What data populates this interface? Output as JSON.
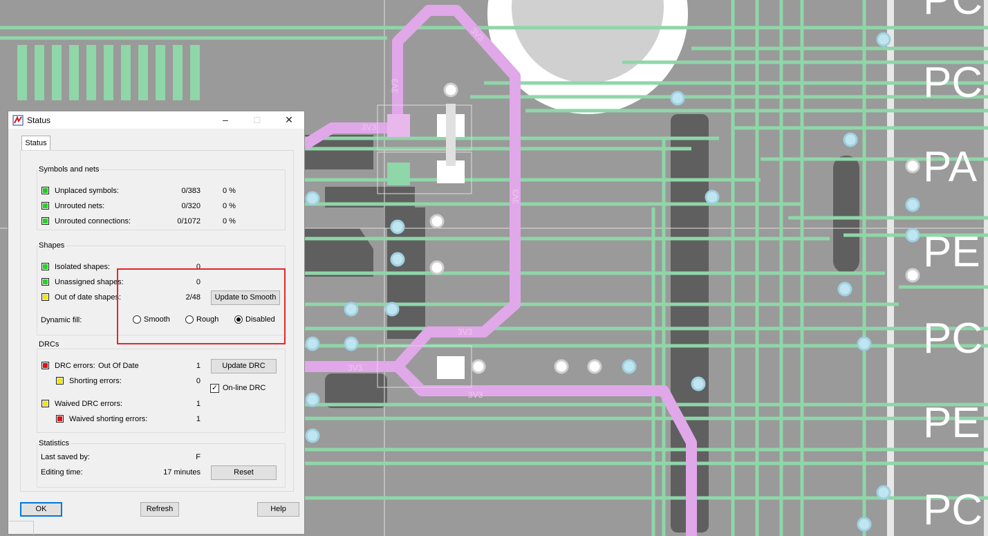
{
  "pcb": {
    "net_labels": [
      "3V3",
      "3V3",
      "3V3",
      "3V3",
      "3V3",
      "3V3",
      "3V3"
    ],
    "silk_labels": [
      "PC",
      "PC",
      "PA",
      "PE",
      "PC",
      "PE",
      "PC"
    ]
  },
  "dialog": {
    "title": "Status",
    "controls": {
      "minimize": "–",
      "maximize": "□",
      "close": "✕"
    },
    "tab": "Status",
    "symbols_nets": {
      "title": "Symbols and nets",
      "rows": [
        {
          "label": "Unplaced symbols:",
          "count": "0/383",
          "pct": "0 %",
          "color": "#22c822"
        },
        {
          "label": "Unrouted nets:",
          "count": "0/320",
          "pct": "0 %",
          "color": "#22d522"
        },
        {
          "label": "Unrouted connections:",
          "count": "0/1072",
          "pct": "0 %",
          "color": "#22d522"
        }
      ]
    },
    "shapes": {
      "title": "Shapes",
      "rows": [
        {
          "label": "Isolated shapes:",
          "count": "0",
          "color": "#22d522"
        },
        {
          "label": "Unassigned shapes:",
          "count": "0",
          "color": "#22d522"
        },
        {
          "label": "Out of date shapes:",
          "count": "2/48",
          "color": "#f0e800"
        }
      ],
      "update_button": "Update to Smooth",
      "dynamic_fill_label": "Dynamic fill:",
      "options": [
        "Smooth",
        "Rough",
        "Disabled"
      ],
      "selected": "Disabled"
    },
    "drcs": {
      "title": "DRCs",
      "drc_errors": {
        "label": "DRC errors:",
        "status": "Out Of Date",
        "count": "1",
        "color": "#e01010"
      },
      "shorting_errors": {
        "label": "Shorting errors:",
        "count": "0",
        "color": "#f0e800"
      },
      "waived_drc": {
        "label": "Waived DRC errors:",
        "count": "1",
        "color": "#f0e800"
      },
      "waived_shorting": {
        "label": "Waived shorting errors:",
        "count": "1",
        "color": "#e01010"
      },
      "update_button": "Update DRC",
      "online_drc": "On-line DRC",
      "online_checked": true
    },
    "statistics": {
      "title": "Statistics",
      "last_saved_label": "Last saved by:",
      "last_saved_value": "F",
      "editing_label": "Editing time:",
      "editing_value": "17 minutes",
      "reset_button": "Reset"
    },
    "footer": {
      "ok": "OK",
      "refresh": "Refresh",
      "help": "Help"
    }
  }
}
